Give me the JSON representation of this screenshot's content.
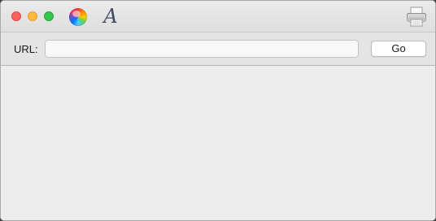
{
  "window": {
    "traffic_lights": [
      "close",
      "minimize",
      "zoom"
    ],
    "toolbar_icons": [
      "color-wheel-icon",
      "font-icon",
      "print-icon"
    ],
    "font_icon_glyph": "A"
  },
  "url_bar": {
    "label": "URL:",
    "value": "",
    "placeholder": "",
    "go_label": "Go"
  },
  "colors": {
    "close": "#fc605c",
    "minimize": "#fdbc40",
    "zoom": "#34c84a",
    "window_bg": "#ececec"
  }
}
